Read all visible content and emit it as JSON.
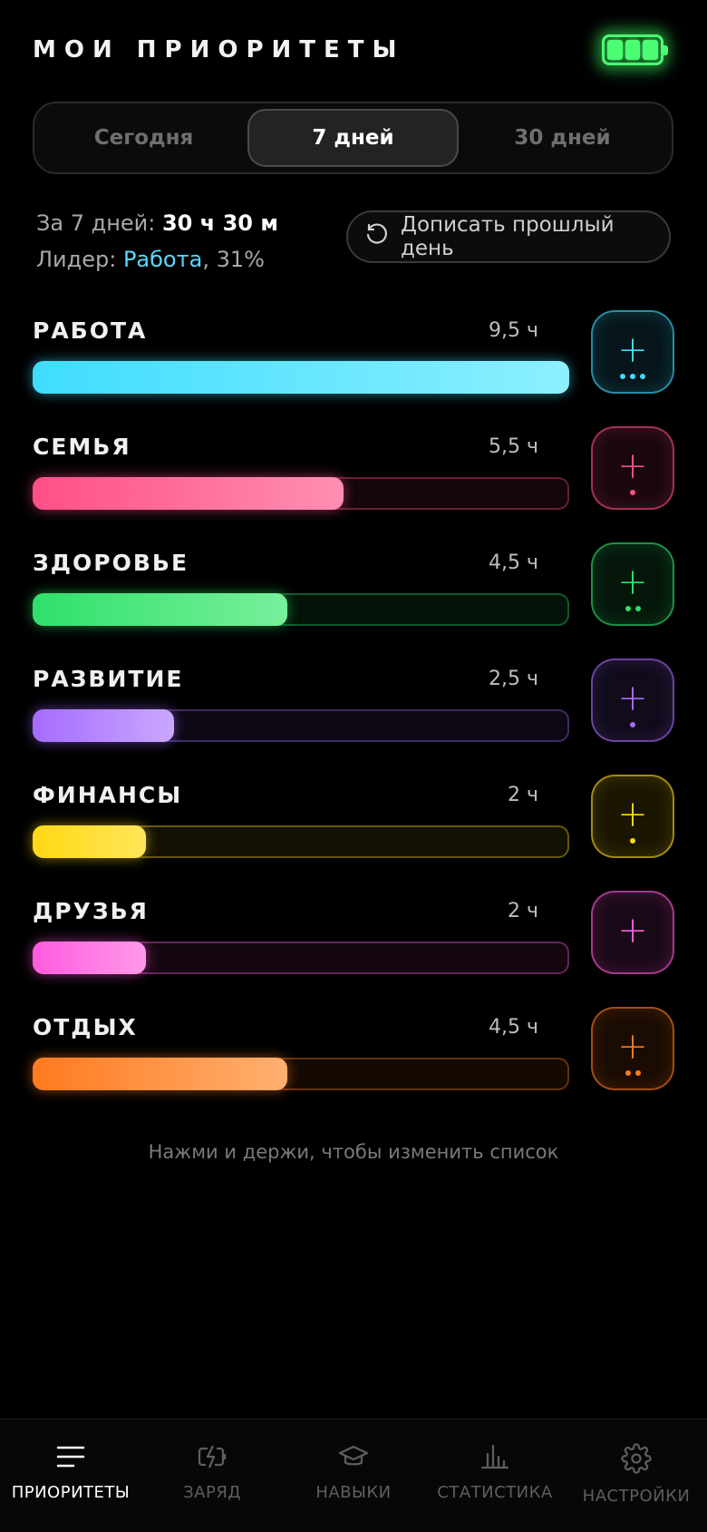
{
  "header": {
    "title": "МОИ ПРИОРИТЕТЫ"
  },
  "period_tabs": [
    {
      "label": "Сегодня",
      "active": false
    },
    {
      "label": "7 дней",
      "active": true
    },
    {
      "label": "30 дней",
      "active": false
    }
  ],
  "summary": {
    "total_prefix": "За 7 дней: ",
    "total_value": "30 ч 30 м",
    "leader_prefix": "Лидер: ",
    "leader_name": "Работа",
    "leader_share": ", 31%"
  },
  "backfill_button": {
    "label": "Дописать прошлый день",
    "icon": "history-icon"
  },
  "priorities": [
    {
      "name": "РАБОТА",
      "hours": "9,5 ч",
      "fraction": 1.0,
      "color": "#3fdcff",
      "color2": "#8df0ff",
      "dots": 3
    },
    {
      "name": "СЕМЬЯ",
      "hours": "5,5 ч",
      "fraction": 0.579,
      "color": "#ff4f86",
      "color2": "#ff8fb2",
      "dots": 1
    },
    {
      "name": "ЗДОРОВЬЕ",
      "hours": "4,5 ч",
      "fraction": 0.474,
      "color": "#2fe06a",
      "color2": "#78f09c",
      "dots": 2
    },
    {
      "name": "РАЗВИТИЕ",
      "hours": "2,5 ч",
      "fraction": 0.263,
      "color": "#a56bff",
      "color2": "#c9a8ff",
      "dots": 1
    },
    {
      "name": "ФИНАНСЫ",
      "hours": "2 ч",
      "fraction": 0.211,
      "color": "#ffd814",
      "color2": "#ffe65a",
      "dots": 1
    },
    {
      "name": "ДРУЗЬЯ",
      "hours": "2 ч",
      "fraction": 0.211,
      "color": "#ff5bde",
      "color2": "#ff9ae9",
      "dots": 0
    },
    {
      "name": "ОТДЫХ",
      "hours": "4,5 ч",
      "fraction": 0.474,
      "color": "#ff7a1f",
      "color2": "#ffb070",
      "dots": 2
    }
  ],
  "add_button_symbol": "+",
  "hint": "Нажми и держи, чтобы изменить список",
  "tabbar": [
    {
      "label": "ПРИОРИТЕТЫ",
      "icon": "list-icon",
      "active": true
    },
    {
      "label": "ЗАРЯД",
      "icon": "charge-icon",
      "active": false
    },
    {
      "label": "НАВЫКИ",
      "icon": "graduation-cap-icon",
      "active": false
    },
    {
      "label": "СТАТИСТИКА",
      "icon": "bar-chart-icon",
      "active": false
    },
    {
      "label": "НАСТРОЙКИ",
      "icon": "gear-icon",
      "active": false
    }
  ]
}
